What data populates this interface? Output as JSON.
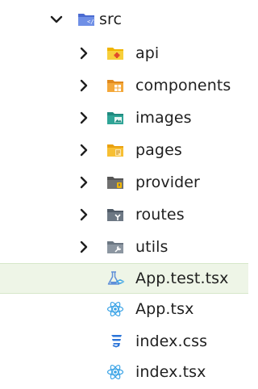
{
  "explorer": {
    "root": {
      "label": "src",
      "icon": "src-folder-icon",
      "expanded": true
    },
    "folders": [
      {
        "label": "api",
        "icon": "api-folder-icon"
      },
      {
        "label": "components",
        "icon": "components-folder-icon"
      },
      {
        "label": "images",
        "icon": "images-folder-icon"
      },
      {
        "label": "pages",
        "icon": "pages-folder-icon"
      },
      {
        "label": "provider",
        "icon": "provider-folder-icon"
      },
      {
        "label": "routes",
        "icon": "routes-folder-icon"
      },
      {
        "label": "utils",
        "icon": "utils-folder-icon"
      }
    ],
    "files": [
      {
        "label": "App.test.tsx",
        "icon": "test-flask-icon",
        "selected": true
      },
      {
        "label": "App.tsx",
        "icon": "react-icon"
      },
      {
        "label": "index.css",
        "icon": "css-icon"
      },
      {
        "label": "index.tsx",
        "icon": "react-icon"
      }
    ]
  },
  "colors": {
    "selected_bg": "#eef5e7",
    "src_folder": "#4b6bd1",
    "api_folder": "#f5c518",
    "components_folder": "#f0a53a",
    "images_folder": "#2a9a8f",
    "pages_folder": "#f5b526",
    "provider_folder": "#6b6b6b",
    "routes_folder": "#5f6b78",
    "utils_folder": "#7b8794",
    "react_blue": "#3aa3e6",
    "css_blue": "#2b74d8",
    "test_blue": "#5f8fd8"
  }
}
